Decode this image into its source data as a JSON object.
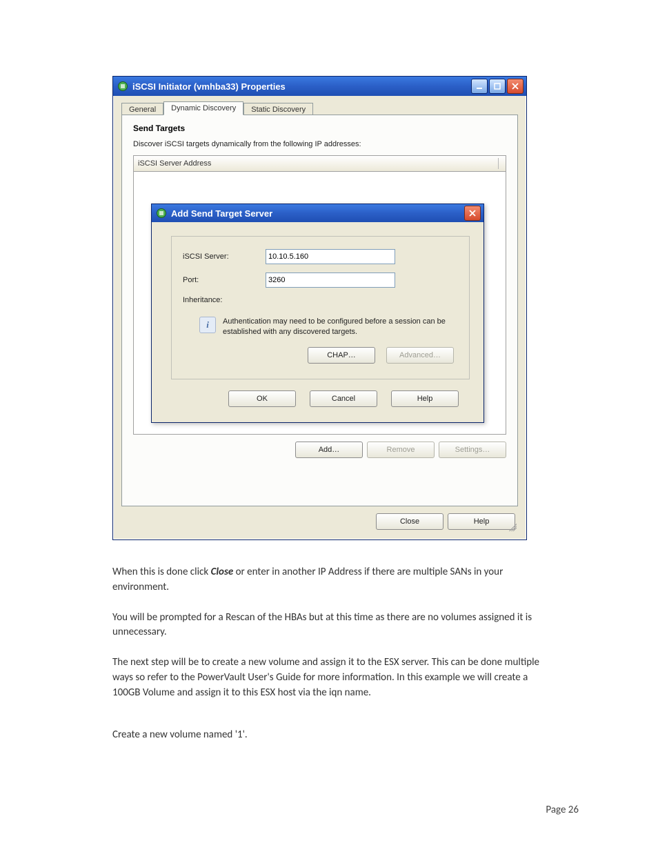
{
  "window": {
    "title": "iSCSI Initiator (vmhba33) Properties",
    "tabs": [
      {
        "label": "General"
      },
      {
        "label": "Dynamic Discovery"
      },
      {
        "label": "Static Discovery"
      }
    ],
    "active_tab_index": 1,
    "section_title": "Send Targets",
    "section_desc": "Discover iSCSI targets dynamically from the following IP addresses:",
    "list_header": "iSCSI Server Address",
    "buttons": {
      "add": "Add…",
      "remove": "Remove",
      "settings": "Settings…",
      "close": "Close",
      "help": "Help"
    }
  },
  "dialog": {
    "title": "Add Send Target Server",
    "fields": {
      "iscsi_server_label": "iSCSI Server:",
      "iscsi_server_value": "10.10.5.160",
      "port_label": "Port:",
      "port_value": "3260",
      "inheritance_label": "Inheritance:"
    },
    "info_text": "Authentication may need to be configured before a session can be established with any discovered targets.",
    "buttons": {
      "chap": "CHAP…",
      "advanced": "Advanced…",
      "ok": "OK",
      "cancel": "Cancel",
      "help": "Help"
    }
  },
  "doc": {
    "p1_pre": "When this is done click ",
    "p1_strong": "Close",
    "p1_post": " or enter in another IP Address if there are multiple SANs in your environment.",
    "p2": "You will be prompted for a Rescan of the HBAs but at this time as there are no volumes assigned it is unnecessary.",
    "p3": "The next step will be to create a new volume and assign it to the ESX server. This can be done multiple ways so refer to the PowerVault User's Guide for more information. In this example we will create a 100GB Volume and assign it to this ESX host via the iqn name.",
    "p4": "Create a new volume named '1'."
  },
  "page_number": "Page 26"
}
